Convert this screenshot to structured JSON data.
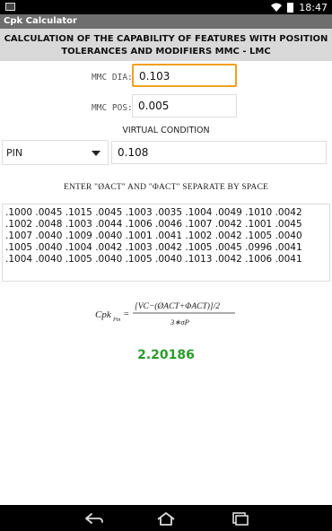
{
  "status_bar": {
    "time": "18:47"
  },
  "app": {
    "title": "Cpk Calculator"
  },
  "header": {
    "line1": "CALCULATION OF THE CAPABILITY OF FEATURES WITH POSITION",
    "line2": "TOLERANCES AND MODIFIERS MMC - LMC"
  },
  "fields": {
    "mmc_dia_label": "MMC DIA:",
    "mmc_dia_value": "0.103",
    "mmc_pos_label": "MMC POS:",
    "mmc_pos_value": "0.005",
    "virtual_condition_label": "VIRTUAL CONDITION",
    "feature_type": "PIN",
    "virtual_condition_value": "0.108"
  },
  "instructions": {
    "enter_label": "ENTER \"ØACT\" AND \"ΦACT\" SEPARATE BY SPACE"
  },
  "data_input": {
    "text": ".1000 .0045 .1015 .0045 .1003 .0035 .1004 .0049 .1010 .0042 .1002 .0048 .1003 .0044 .1006 .0046 .1007 .0042 .1001 .0045 .1007 .0040 .1009 .0040 .1001 .0041 .1002 .0042 .1005 .0040 .1005 .0040 .1004 .0042 .1003 .0042 .1005 .0045 .0996 .0041 .1004 .0040 .1005 .0040 .1005 .0040 .1013 .0042 .1006 .0041"
  },
  "formula": {
    "lhs": "Cpk",
    "lhs_sub": "Pin",
    "numerator": "[VC−(ØACT+ΦACT)]/2",
    "denominator": "3∗σP"
  },
  "result": {
    "value": "2.20186"
  },
  "icons": {
    "back": "back-icon",
    "home": "home-icon",
    "recents": "recents-icon"
  }
}
